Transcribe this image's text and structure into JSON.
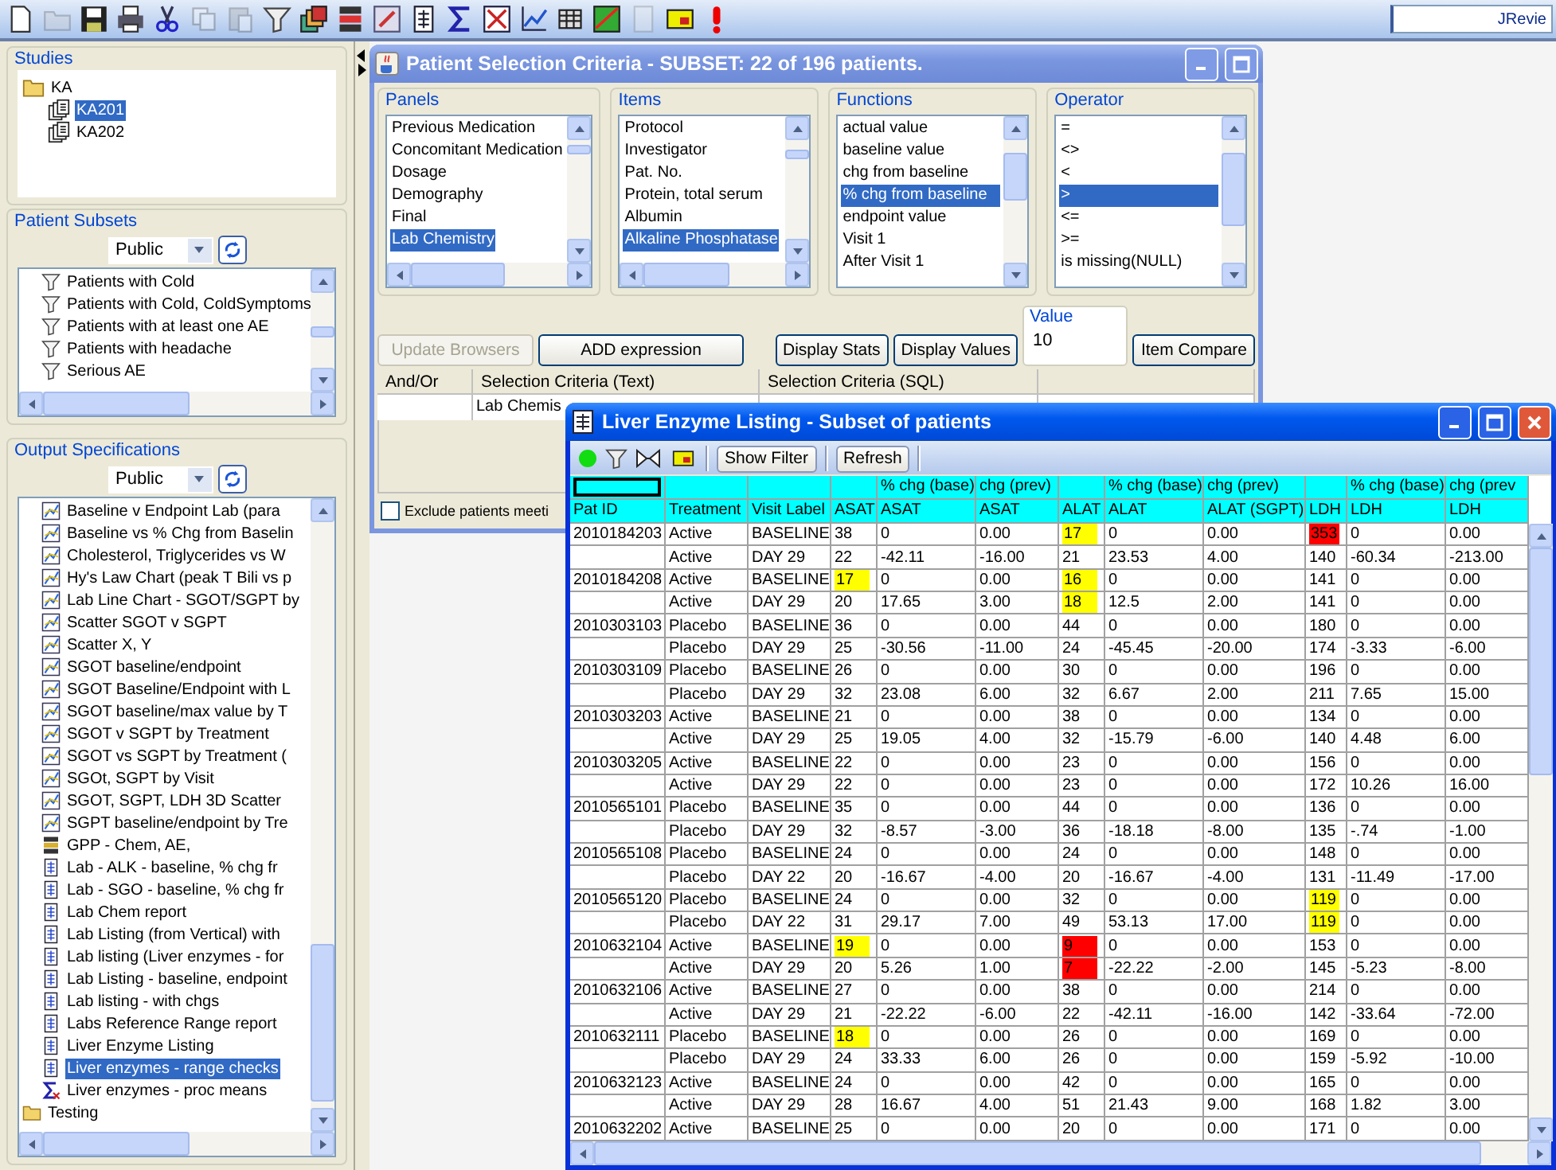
{
  "toolbar": {
    "buttons": [
      {
        "disabled": false
      },
      {
        "disabled": true
      },
      {
        "disabled": false
      },
      {
        "disabled": false
      },
      {
        "disabled": false
      },
      {
        "disabled": true
      },
      {
        "disabled": true
      },
      {
        "disabled": false
      },
      {
        "disabled": false
      },
      {
        "disabled": false
      },
      {
        "disabled": false
      },
      {
        "disabled": false
      },
      {
        "disabled": false
      },
      {
        "disabled": false
      },
      {
        "disabled": false
      },
      {
        "disabled": false
      },
      {
        "disabled": false
      },
      {
        "disabled": true
      },
      {
        "disabled": false
      },
      {
        "disabled": false
      }
    ],
    "search_value": "JRevie"
  },
  "sidebar": {
    "studies": {
      "title": "Studies",
      "tree": [
        {
          "label": "KA",
          "expanded": true,
          "selected": false,
          "children": [
            {
              "label": "KA201",
              "selected": true
            },
            {
              "label": "KA202",
              "selected": false
            }
          ]
        }
      ]
    },
    "patient_subsets": {
      "title": "Patient Subsets",
      "dropdown": "Public",
      "items": [
        {
          "label": "Patients with Cold",
          "selected": false
        },
        {
          "label": "Patients with Cold, ColdSymptoms",
          "selected": false
        },
        {
          "label": "Patients with at least one AE",
          "selected": false
        },
        {
          "label": "Patients with headache",
          "selected": false
        },
        {
          "label": "Serious AE",
          "selected": false
        }
      ]
    },
    "output_specifications": {
      "title": "Output Specifications",
      "dropdown": "Public",
      "items": [
        {
          "label": "Baseline v Endpoint Lab (para",
          "kind": "chart",
          "selected": false
        },
        {
          "label": "Baseline vs % Chg from Baselin",
          "kind": "chart",
          "selected": false
        },
        {
          "label": "Cholesterol, Triglycerides vs W",
          "kind": "chart",
          "selected": false
        },
        {
          "label": "Hy's Law Chart (peak T Bili vs p",
          "kind": "chart",
          "selected": false
        },
        {
          "label": "Lab Line Chart - SGOT/SGPT by",
          "kind": "chart",
          "selected": false
        },
        {
          "label": "Scatter SGOT v SGPT",
          "kind": "chart",
          "selected": false
        },
        {
          "label": "Scatter X, Y",
          "kind": "chart",
          "selected": false
        },
        {
          "label": "SGOT baseline/endpoint",
          "kind": "chart",
          "selected": false
        },
        {
          "label": "SGOT Baseline/Endpoint with L",
          "kind": "chart",
          "selected": false
        },
        {
          "label": "SGOT baseline/max value by T",
          "kind": "chart",
          "selected": false
        },
        {
          "label": "SGOT v SGPT by Treatment",
          "kind": "chart",
          "selected": false
        },
        {
          "label": "SGOT vs SGPT by Treatment (",
          "kind": "chart",
          "selected": false
        },
        {
          "label": "SGOt, SGPT by Visit",
          "kind": "chart",
          "selected": false
        },
        {
          "label": "SGOT, SGPT, LDH 3D Scatter",
          "kind": "chart",
          "selected": false
        },
        {
          "label": "SGPT baseline/endpoint by Tre",
          "kind": "chart",
          "selected": false
        },
        {
          "label": "GPP - Chem, AE,",
          "kind": "panel",
          "selected": false
        },
        {
          "label": "Lab - ALK - baseline, % chg fr",
          "kind": "report",
          "selected": false
        },
        {
          "label": "Lab - SGO - baseline, % chg fr",
          "kind": "report",
          "selected": false
        },
        {
          "label": "Lab Chem report",
          "kind": "report",
          "selected": false
        },
        {
          "label": "Lab Listing (from Vertical) with",
          "kind": "report",
          "selected": false
        },
        {
          "label": "Lab listing (Liver enzymes - for",
          "kind": "report",
          "selected": false
        },
        {
          "label": "Lab Listing - baseline, endpoint",
          "kind": "report",
          "selected": false
        },
        {
          "label": "Lab listing - with chgs",
          "kind": "report",
          "selected": false
        },
        {
          "label": "Labs Reference Range report",
          "kind": "report",
          "selected": false
        },
        {
          "label": "Liver Enzyme Listing",
          "kind": "report",
          "selected": false
        },
        {
          "label": "Liver enzymes - range checks",
          "kind": "report",
          "selected": true
        },
        {
          "label": "Liver enzymes - proc means",
          "kind": "stats",
          "selected": false
        },
        {
          "label": "Testing",
          "kind": "folder",
          "selected": false
        }
      ]
    }
  },
  "patient_selection": {
    "title": "Patient Selection Criteria - SUBSET: 22 of 196 patients.",
    "lists": [
      {
        "title": "Panels",
        "items": [
          {
            "label": "Previous Medication",
            "selected": false
          },
          {
            "label": "Concomitant Medication",
            "selected": false
          },
          {
            "label": "Dosage",
            "selected": false
          },
          {
            "label": "Demography",
            "selected": false
          },
          {
            "label": "Final",
            "selected": false
          },
          {
            "label": "Lab Chemistry",
            "selected": true
          }
        ]
      },
      {
        "title": "Items",
        "items": [
          {
            "label": "Protocol",
            "selected": false
          },
          {
            "label": "Investigator",
            "selected": false
          },
          {
            "label": "Pat. No.",
            "selected": false
          },
          {
            "label": "Protein, total serum",
            "selected": false
          },
          {
            "label": "Albumin",
            "selected": false
          },
          {
            "label": "Alkaline Phosphatase",
            "selected": true
          }
        ]
      },
      {
        "title": "Functions",
        "items": [
          {
            "label": "actual value",
            "selected": false
          },
          {
            "label": "baseline value",
            "selected": false
          },
          {
            "label": "chg from baseline",
            "selected": false
          },
          {
            "label": "% chg from baseline",
            "selected": true
          },
          {
            "label": "endpoint value",
            "selected": false
          },
          {
            "label": "Visit 1",
            "selected": false
          },
          {
            "label": "After Visit 1",
            "selected": false
          }
        ]
      },
      {
        "title": "Operator",
        "items": [
          {
            "label": "=",
            "selected": false
          },
          {
            "label": "<>",
            "selected": false
          },
          {
            "label": "<",
            "selected": false
          },
          {
            "label": ">",
            "selected": true
          },
          {
            "label": "<=",
            "selected": false
          },
          {
            "label": ">=",
            "selected": false
          },
          {
            "label": "is missing(NULL)",
            "selected": false
          }
        ]
      }
    ],
    "buttons": [
      {
        "label": "Update Browsers",
        "disabled": true
      },
      {
        "label": "ADD expression",
        "disabled": false
      },
      {
        "label": "Display Stats",
        "disabled": false
      },
      {
        "label": "Display Values",
        "disabled": false
      }
    ],
    "value": {
      "title": "Value",
      "value": "10"
    },
    "item_compare": "Item Compare",
    "criteria_table": {
      "columns": [
        "And/Or",
        "Selection Criteria (Text)",
        "Selection Criteria (SQL)"
      ],
      "rows": [
        {
          "text": "Lab Chemis"
        }
      ]
    },
    "exclude": {
      "label": "Exclude patients meeti",
      "checked": false
    }
  },
  "liver_listing": {
    "title": "Liver Enzyme Listing - Subset of patients",
    "toolbar": [
      "Show Filter",
      "Refresh"
    ],
    "columns": [
      {
        "label": "Pat ID"
      },
      {
        "label": "Treatment"
      },
      {
        "label": "Visit Label"
      },
      {
        "label": "ASAT"
      },
      {
        "label": "ASAT",
        "group": "% chg (base)"
      },
      {
        "label": "ASAT",
        "group": "chg (prev)"
      },
      {
        "label": "ALAT"
      },
      {
        "label": "ALAT",
        "group": "% chg (base)"
      },
      {
        "label": "ALAT (SGPT)",
        "group": "chg (prev)"
      },
      {
        "label": "LDH"
      },
      {
        "label": "LDH",
        "group": "% chg (base)"
      },
      {
        "label": "LDH",
        "group": "chg (prev"
      }
    ],
    "rows": [
      {
        "cells": [
          "2010184203",
          "Active",
          "BASELINE",
          "38",
          "0",
          "0.00",
          {
            "text": "17",
            "color": "#ffff00"
          },
          "0",
          "0.00",
          {
            "text": "353",
            "color": "#ff0000"
          },
          "0",
          "0.00"
        ]
      },
      {
        "cells": [
          null,
          "Active",
          "DAY 29",
          "22",
          "-42.11",
          "-16.00",
          "21",
          "23.53",
          "4.00",
          "140",
          "-60.34",
          "-213.00"
        ]
      },
      {
        "cells": [
          "2010184208",
          "Active",
          "BASELINE",
          {
            "text": "17",
            "color": "#ffff00"
          },
          "0",
          "0.00",
          {
            "text": "16",
            "color": "#ffff00"
          },
          "0",
          "0.00",
          "141",
          "0",
          "0.00"
        ]
      },
      {
        "cells": [
          null,
          "Active",
          "DAY 29",
          "20",
          "17.65",
          "3.00",
          {
            "text": "18",
            "color": "#ffff00"
          },
          "12.5",
          "2.00",
          "141",
          "0",
          "0.00"
        ]
      },
      {
        "cells": [
          "2010303103",
          "Placebo",
          "BASELINE",
          "36",
          "0",
          "0.00",
          "44",
          "0",
          "0.00",
          "180",
          "0",
          "0.00"
        ]
      },
      {
        "cells": [
          null,
          "Placebo",
          "DAY 29",
          "25",
          "-30.56",
          "-11.00",
          "24",
          "-45.45",
          "-20.00",
          "174",
          "-3.33",
          "-6.00"
        ]
      },
      {
        "cells": [
          "2010303109",
          "Placebo",
          "BASELINE",
          "26",
          "0",
          "0.00",
          "30",
          "0",
          "0.00",
          "196",
          "0",
          "0.00"
        ]
      },
      {
        "cells": [
          null,
          "Placebo",
          "DAY 29",
          "32",
          "23.08",
          "6.00",
          "32",
          "6.67",
          "2.00",
          "211",
          "7.65",
          "15.00"
        ]
      },
      {
        "cells": [
          "2010303203",
          "Active",
          "BASELINE",
          "21",
          "0",
          "0.00",
          "38",
          "0",
          "0.00",
          "134",
          "0",
          "0.00"
        ]
      },
      {
        "cells": [
          null,
          "Active",
          "DAY 29",
          "25",
          "19.05",
          "4.00",
          "32",
          "-15.79",
          "-6.00",
          "140",
          "4.48",
          "6.00"
        ]
      },
      {
        "cells": [
          "2010303205",
          "Active",
          "BASELINE",
          "22",
          "0",
          "0.00",
          "23",
          "0",
          "0.00",
          "156",
          "0",
          "0.00"
        ]
      },
      {
        "cells": [
          null,
          "Active",
          "DAY 29",
          "22",
          "0",
          "0.00",
          "23",
          "0",
          "0.00",
          "172",
          "10.26",
          "16.00"
        ]
      },
      {
        "cells": [
          "2010565101",
          "Placebo",
          "BASELINE",
          "35",
          "0",
          "0.00",
          "44",
          "0",
          "0.00",
          "136",
          "0",
          "0.00"
        ]
      },
      {
        "cells": [
          null,
          "Placebo",
          "DAY 29",
          "32",
          "-8.57",
          "-3.00",
          "36",
          "-18.18",
          "-8.00",
          "135",
          "-.74",
          "-1.00"
        ]
      },
      {
        "cells": [
          "2010565108",
          "Placebo",
          "BASELINE",
          "24",
          "0",
          "0.00",
          "24",
          "0",
          "0.00",
          "148",
          "0",
          "0.00"
        ]
      },
      {
        "cells": [
          null,
          "Placebo",
          "DAY 22",
          "20",
          "-16.67",
          "-4.00",
          "20",
          "-16.67",
          "-4.00",
          "131",
          "-11.49",
          "-17.00"
        ]
      },
      {
        "cells": [
          "2010565120",
          "Placebo",
          "BASELINE",
          "24",
          "0",
          "0.00",
          "32",
          "0",
          "0.00",
          {
            "text": "119",
            "color": "#ffff00"
          },
          "0",
          "0.00"
        ]
      },
      {
        "cells": [
          null,
          "Placebo",
          "DAY 22",
          "31",
          "29.17",
          "7.00",
          "49",
          "53.13",
          "17.00",
          {
            "text": "119",
            "color": "#ffff00"
          },
          "0",
          "0.00"
        ]
      },
      {
        "cells": [
          "2010632104",
          "Active",
          "BASELINE",
          {
            "text": "19",
            "color": "#ffff00"
          },
          "0",
          "0.00",
          {
            "text": "9",
            "color": "#ff0000"
          },
          "0",
          "0.00",
          "153",
          "0",
          "0.00"
        ]
      },
      {
        "cells": [
          null,
          "Active",
          "DAY 29",
          "20",
          "5.26",
          "1.00",
          {
            "text": "7",
            "color": "#ff0000"
          },
          "-22.22",
          "-2.00",
          "145",
          "-5.23",
          "-8.00"
        ]
      },
      {
        "cells": [
          "2010632106",
          "Active",
          "BASELINE",
          "27",
          "0",
          "0.00",
          "38",
          "0",
          "0.00",
          "214",
          "0",
          "0.00"
        ]
      },
      {
        "cells": [
          null,
          "Active",
          "DAY 29",
          "21",
          "-22.22",
          "-6.00",
          "22",
          "-42.11",
          "-16.00",
          "142",
          "-33.64",
          "-72.00"
        ]
      },
      {
        "cells": [
          "2010632111",
          "Placebo",
          "BASELINE",
          {
            "text": "18",
            "color": "#ffff00"
          },
          "0",
          "0.00",
          "26",
          "0",
          "0.00",
          "169",
          "0",
          "0.00"
        ]
      },
      {
        "cells": [
          null,
          "Placebo",
          "DAY 29",
          "24",
          "33.33",
          "6.00",
          "26",
          "0",
          "0.00",
          "159",
          "-5.92",
          "-10.00"
        ]
      },
      {
        "cells": [
          "2010632123",
          "Active",
          "BASELINE",
          "24",
          "0",
          "0.00",
          "42",
          "0",
          "0.00",
          "165",
          "0",
          "0.00"
        ]
      },
      {
        "cells": [
          null,
          "Active",
          "DAY 29",
          "28",
          "16.67",
          "4.00",
          "51",
          "21.43",
          "9.00",
          "168",
          "1.82",
          "3.00"
        ]
      },
      {
        "cells": [
          "2010632202",
          "Active",
          "BASELINE",
          "25",
          "0",
          "0.00",
          "20",
          "0",
          "0.00",
          "171",
          "0",
          "0.00"
        ]
      }
    ]
  }
}
